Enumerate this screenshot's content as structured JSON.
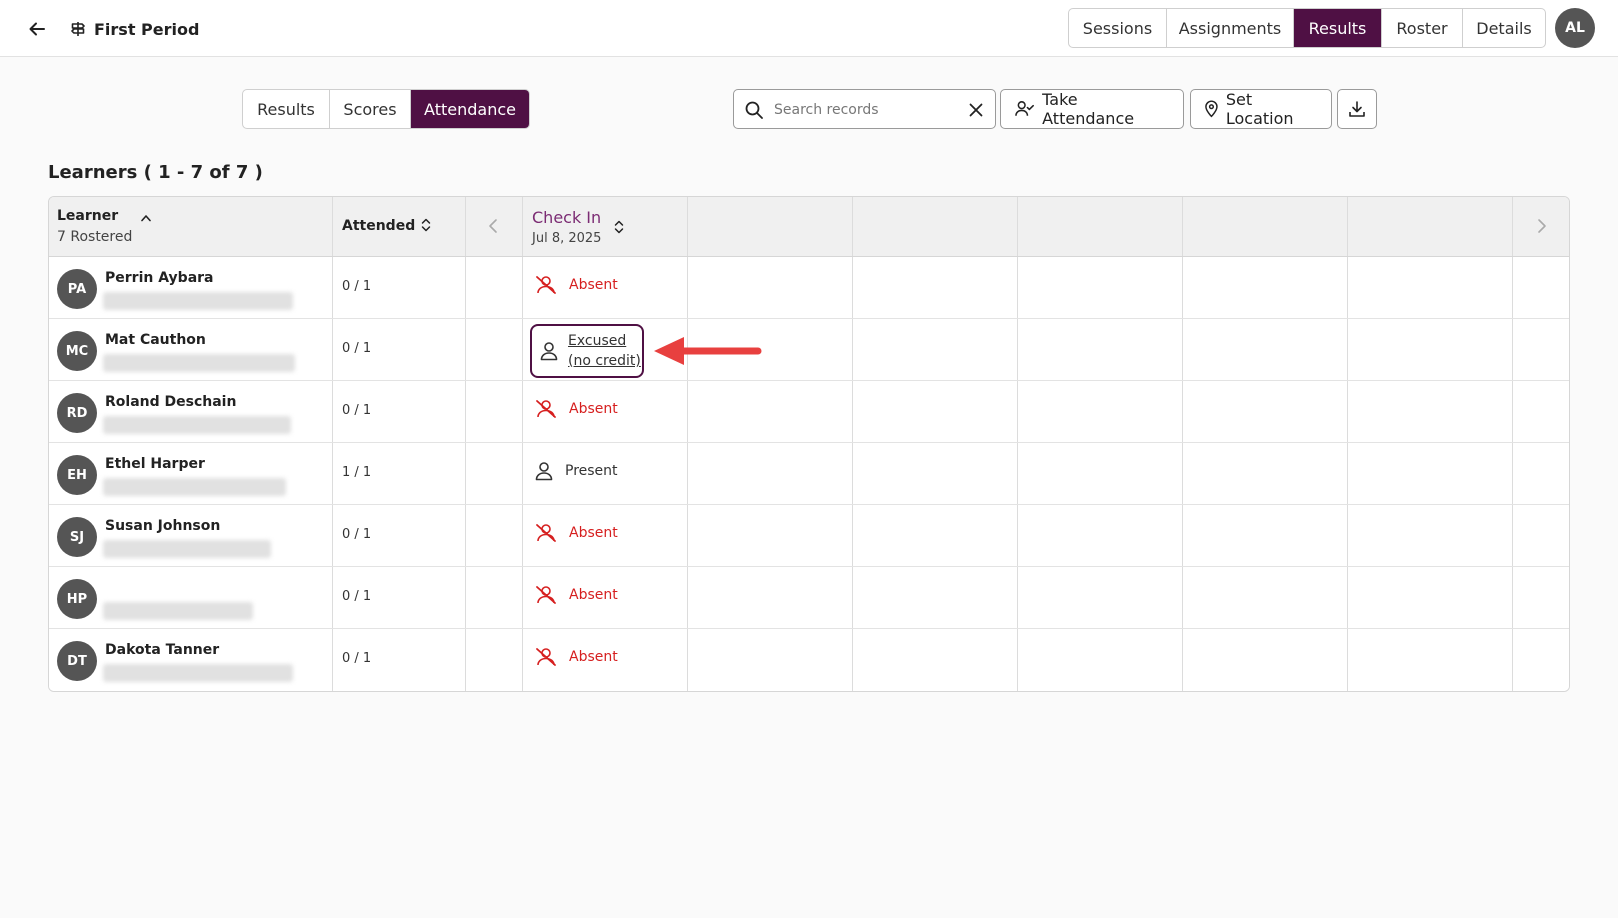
{
  "header": {
    "title": "First Period",
    "tabs": [
      {
        "label": "Sessions",
        "active": false
      },
      {
        "label": "Assignments",
        "active": false
      },
      {
        "label": "Results",
        "active": true
      },
      {
        "label": "Roster",
        "active": false
      },
      {
        "label": "Details",
        "active": false
      }
    ],
    "user_initials": "AL"
  },
  "subtabs": [
    {
      "label": "Results",
      "active": false
    },
    {
      "label": "Scores",
      "active": false
    },
    {
      "label": "Attendance",
      "active": true
    }
  ],
  "toolbar": {
    "search_placeholder": "Search records",
    "take_attendance_label": "Take Attendance",
    "set_location_label": "Set Location"
  },
  "learners_heading": "Learners ( 1 - 7 of 7 )",
  "table": {
    "learner_header": "Learner",
    "rostered": "7 Rostered",
    "attended_header": "Attended",
    "session_header": "Check In",
    "session_date": "Jul 8, 2025",
    "rows": [
      {
        "initials": "PA",
        "name": "Perrin Aybara",
        "attended": "0 / 1",
        "status": "Absent",
        "status_type": "absent"
      },
      {
        "initials": "MC",
        "name": "Mat Cauthon",
        "attended": "0 / 1",
        "status_line1": "Excused",
        "status_line2": "(no credit)",
        "status_type": "excused"
      },
      {
        "initials": "RD",
        "name": "Roland Deschain",
        "attended": "0 / 1",
        "status": "Absent",
        "status_type": "absent"
      },
      {
        "initials": "EH",
        "name": "Ethel Harper",
        "attended": "1 / 1",
        "status": "Present",
        "status_type": "present"
      },
      {
        "initials": "SJ",
        "name": "Susan Johnson",
        "attended": "0 / 1",
        "status": "Absent",
        "status_type": "absent"
      },
      {
        "initials": "HP",
        "name": "",
        "attended": "0 / 1",
        "status": "Absent",
        "status_type": "absent"
      },
      {
        "initials": "DT",
        "name": "Dakota Tanner",
        "attended": "0 / 1",
        "status": "Absent",
        "status_type": "absent"
      }
    ]
  },
  "colors": {
    "brand": "#4f1044",
    "absent": "#d61f1f",
    "annotation": "#e8403f"
  }
}
